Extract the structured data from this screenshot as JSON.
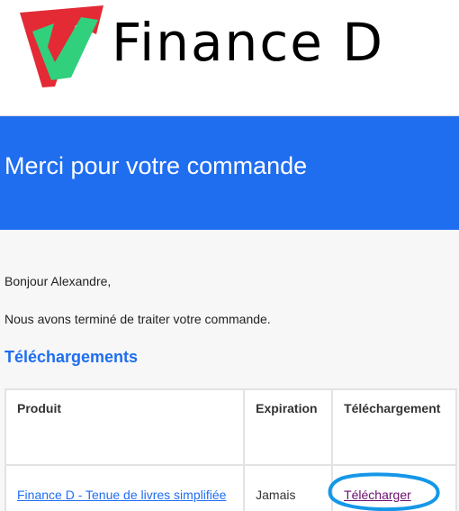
{
  "brand": {
    "name": "Finance D",
    "logo_icon": "finance-d-logo-icon"
  },
  "banner": {
    "title": "Merci pour votre commande"
  },
  "email": {
    "greeting": "Bonjour Alexandre,",
    "message": "Nous avons terminé de traiter votre commande."
  },
  "downloads": {
    "heading": "Téléchargements",
    "columns": [
      "Produit",
      "Expiration",
      "Téléchargement"
    ],
    "rows": [
      {
        "product": "Finance D - Tenue de livres simplifiée",
        "expiration": "Jamais",
        "download": "Télécharger"
      }
    ]
  },
  "colors": {
    "accent": "#1f6ef0",
    "logo_red": "#e32a35",
    "logo_green": "#31d07d",
    "link_visited": "#6b0d6f",
    "highlight": "#1597e8"
  }
}
